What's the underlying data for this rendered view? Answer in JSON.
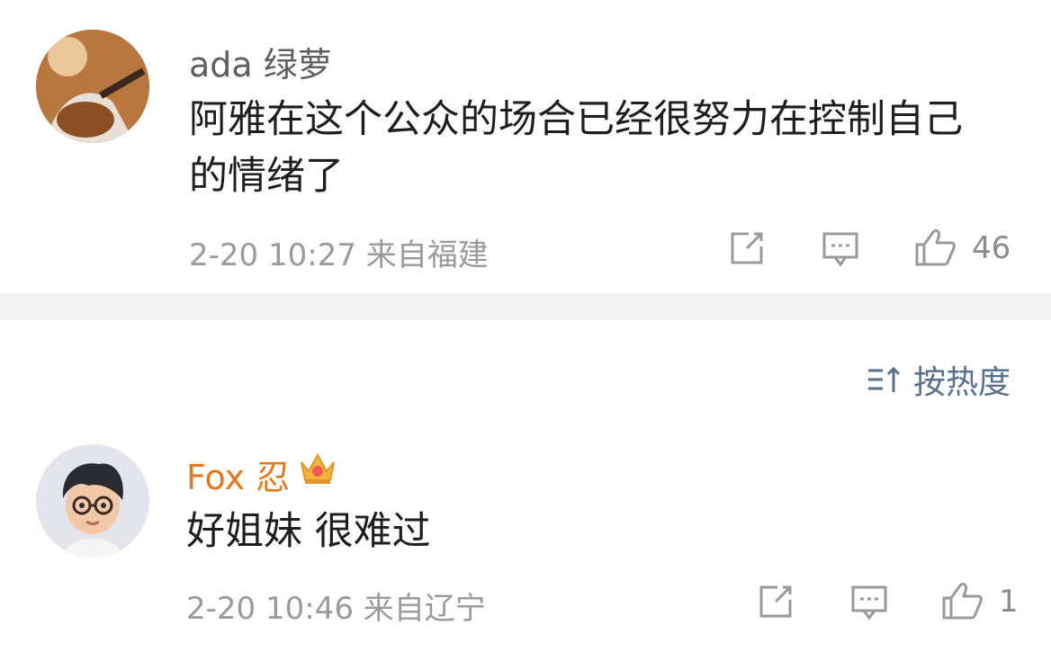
{
  "comments": [
    {
      "username": "ada 绿萝",
      "content": "阿雅在这个公众的场合已经很努力在控制自己的情绪了",
      "meta": "2-20 10:27  来自福建",
      "like_count": "46",
      "avatar_icon": "avatar-photo-guitar"
    },
    {
      "username": "Fox 忍",
      "content": "好姐妹 很难过",
      "meta": "2-20 10:46  来自辽宁",
      "like_count": "1",
      "avatar_icon": "avatar-cartoon-glasses",
      "badge_icon": "crown-icon"
    }
  ],
  "sort": {
    "label": "按热度",
    "icon": "sort-icon"
  },
  "colors": {
    "username_default": "#5f5f5f",
    "username_vip": "#e07a1d",
    "meta": "#9a9a9a",
    "sort": "#5a6f8a",
    "separator": "#f2f2f2"
  }
}
